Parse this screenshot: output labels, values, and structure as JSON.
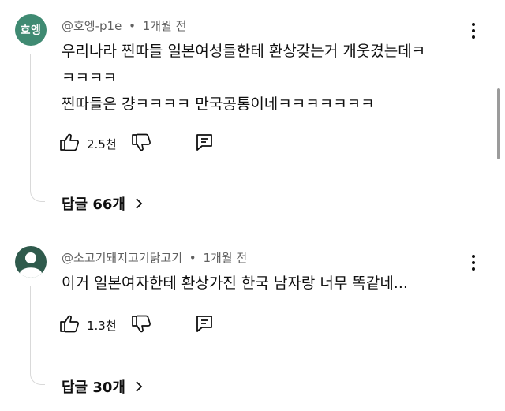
{
  "comments": [
    {
      "avatar_text": "호엥",
      "avatar_color": "#3f8a72",
      "author": "@호엥-p1e",
      "time": "1개월 전",
      "line1": "우리나라 찐따들 일본여성들한테 환상갖는거 개웃겼는데ㅋ",
      "line2": "ㅋㅋㅋㅋ",
      "line3": "찐따들은 걍ㅋㅋㅋㅋ 만국공통이네ㅋㅋㅋㅋㅋㅋㅋ",
      "likes": "2.5천",
      "replies": "답글 66개"
    },
    {
      "avatar_color": "#2f5a4c",
      "author": "@소고기돼지고기닭고기",
      "time": "1개월 전",
      "line1": "이거 일본여자한테 환상가진 한국 남자랑 너무 똑같네...",
      "likes": "1.3천",
      "replies": "답글 30개"
    }
  ],
  "separator": "•",
  "icons": [
    "like-icon",
    "dislike-icon",
    "reply-icon",
    "more-vertical-icon",
    "chevron-right-icon",
    "default-avatar-icon"
  ]
}
